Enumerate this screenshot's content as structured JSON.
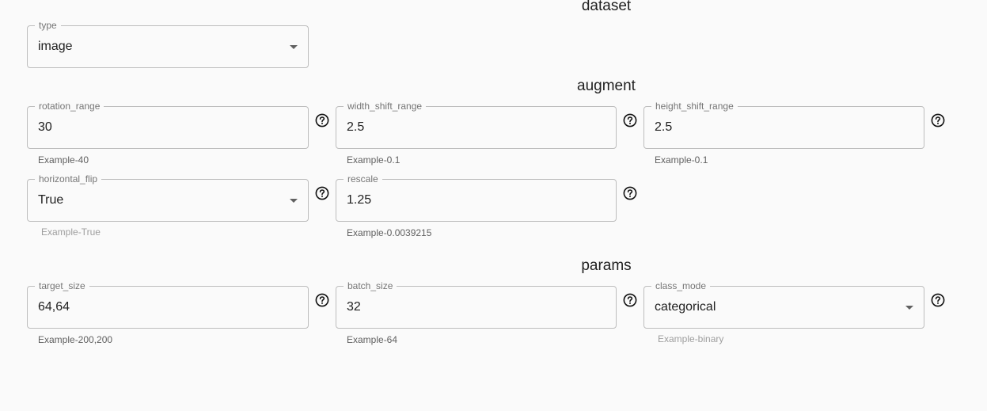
{
  "sections": {
    "dataset": "dataset",
    "augment": "augment",
    "params": "params"
  },
  "dataset": {
    "type": {
      "label": "type",
      "value": "image"
    }
  },
  "augment": {
    "rotation_range": {
      "label": "rotation_range",
      "value": "30",
      "helper": "Example-40"
    },
    "width_shift_range": {
      "label": "width_shift_range",
      "value": "2.5",
      "helper": "Example-0.1"
    },
    "height_shift_range": {
      "label": "height_shift_range",
      "value": "2.5",
      "helper": "Example-0.1"
    },
    "horizontal_flip": {
      "label": "horizontal_flip",
      "value": "True",
      "helper": "Example-True"
    },
    "rescale": {
      "label": "rescale",
      "value": "1.25",
      "helper": "Example-0.0039215"
    }
  },
  "params": {
    "target_size": {
      "label": "target_size",
      "value": "64,64",
      "helper": "Example-200,200"
    },
    "batch_size": {
      "label": "batch_size",
      "value": "32",
      "helper": "Example-64"
    },
    "class_mode": {
      "label": "class_mode",
      "value": "categorical",
      "helper": "Example-binary"
    }
  },
  "icons": {
    "help": "help-circle-icon",
    "dropdown": "arrow-drop-down-icon"
  },
  "colors": {
    "border": "#bdbdbd",
    "text": "#212121",
    "muted": "#757575",
    "background": "#fafafa"
  }
}
